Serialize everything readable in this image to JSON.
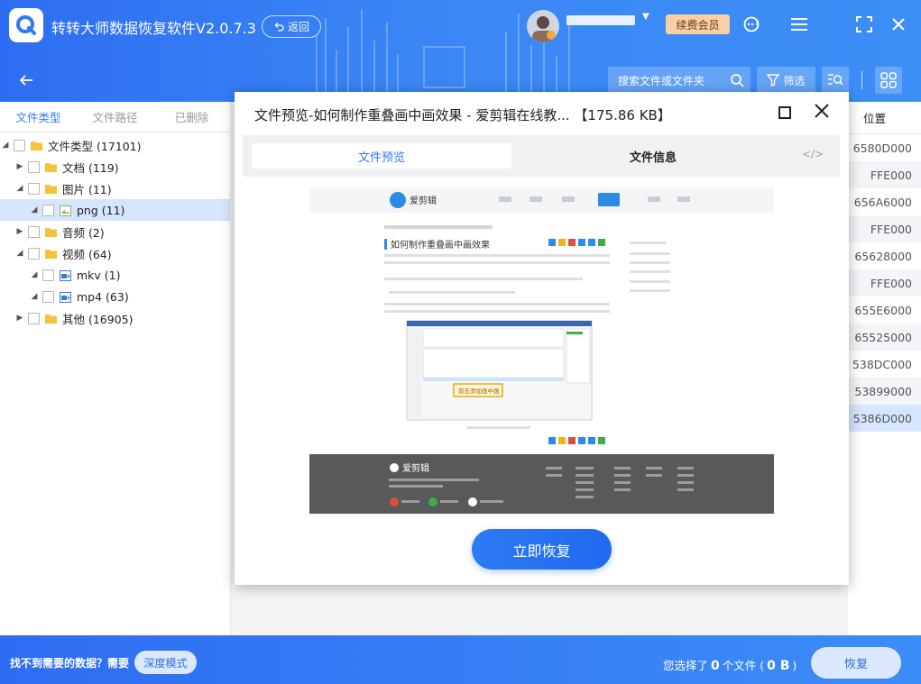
{
  "app": {
    "title": "转转大师数据恢复软件V2.0.7.3",
    "back_label": "返回",
    "vip_label": "续费会员",
    "colors": {
      "primary": "#2f7bf5",
      "vip": "#f9cfa6"
    }
  },
  "toolbar": {
    "search_placeholder": "搜索文件或文件夹",
    "filter_label": "筛选"
  },
  "sidebar": {
    "tabs": [
      "文件类型",
      "文件路径",
      "已删除"
    ],
    "tree": [
      {
        "label": "文件类型 (17101)",
        "level": 0,
        "expanded": true
      },
      {
        "label": "文档 (119)",
        "level": 1,
        "expanded": false
      },
      {
        "label": "图片 (11)",
        "level": 1,
        "expanded": true
      },
      {
        "label": "png (11)",
        "level": 2,
        "expanded": true,
        "selected": true
      },
      {
        "label": "音频 (2)",
        "level": 1,
        "expanded": false
      },
      {
        "label": "视频 (64)",
        "level": 1,
        "expanded": true
      },
      {
        "label": "mkv (1)",
        "level": 2,
        "expanded": true
      },
      {
        "label": "mp4 (63)",
        "level": 2,
        "expanded": true
      },
      {
        "label": "其他 (16905)",
        "level": 1,
        "expanded": false
      }
    ]
  },
  "table": {
    "position_header": "位置",
    "positions": [
      "6580D000",
      "FFE000",
      "656A6000",
      "FFE000",
      "65628000",
      "FFE000",
      "655E6000",
      "65525000",
      "538DC000",
      "53899000",
      "5386D000"
    ],
    "selected_index": 10
  },
  "modal": {
    "title": "文件预览-如何制作重叠画中画效果 - 爱剪辑在线教... 【175.86 KB】",
    "tab_preview": "文件预览",
    "tab_info": "文件信息",
    "code_symbol": "</>",
    "recover_label": "立即恢复",
    "preview": {
      "site_name": "爱剪辑",
      "article_title": "如何制作重叠画中画效果",
      "inner_caption": "双击添加画中画",
      "footer_brand": "爱剪辑"
    }
  },
  "footer": {
    "hint": "找不到需要的数据？需要",
    "deep_mode_label": "深度模式",
    "status_prefix": "您选择了",
    "count": "0",
    "status_middle": "个文件 (",
    "size": "0 B",
    "status_suffix": ")",
    "restore_label": "恢复"
  }
}
